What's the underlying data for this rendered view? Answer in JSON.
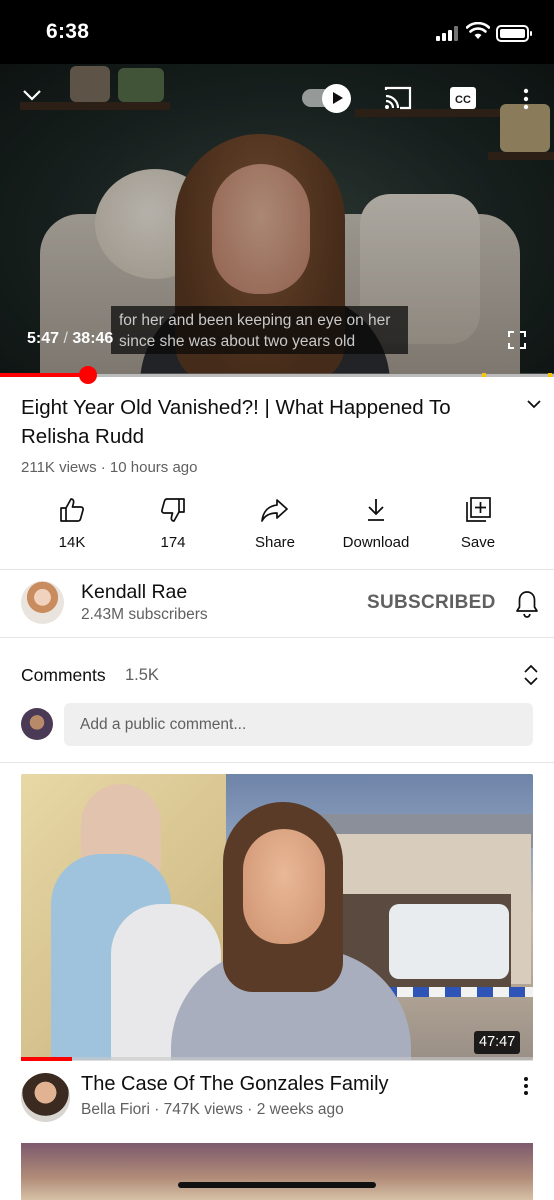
{
  "status_bar": {
    "time": "6:38"
  },
  "player": {
    "caption_line1": "for her and been keeping an eye on her",
    "caption_line2": "since she was about two years old",
    "current_time": "5:47",
    "separator": "/",
    "duration": "38:46",
    "progress_fraction": 0.159,
    "autoplay": "on",
    "icons": [
      "chevron-down-icon",
      "autoplay-toggle",
      "cast-icon",
      "cc-icon",
      "more-vert-icon",
      "fullscreen-icon"
    ]
  },
  "video": {
    "title": "Eight Year Old Vanished?! | What Happened To Relisha Rudd",
    "meta": "211K views · 10 hours ago"
  },
  "actions": [
    {
      "icon": "thumbs-up-icon",
      "label": "14K"
    },
    {
      "icon": "thumbs-down-icon",
      "label": "174"
    },
    {
      "icon": "share-icon",
      "label": "Share"
    },
    {
      "icon": "download-icon",
      "label": "Download"
    },
    {
      "icon": "save-playlist-icon",
      "label": "Save"
    }
  ],
  "channel": {
    "name": "Kendall Rae",
    "subscribers": "2.43M subscribers",
    "subscribe_state": "SUBSCRIBED"
  },
  "comments": {
    "title": "Comments",
    "count": "1.5K",
    "placeholder": "Add a public comment..."
  },
  "next_video": {
    "duration": "47:47",
    "watched_fraction": 0.1,
    "title": "The Case Of The Gonzales Family",
    "meta": "Bella Fiori · 747K views · 2 weeks ago"
  },
  "colors": {
    "accent": "#ff0000",
    "text": "#0f0f0f",
    "secondary": "#606060",
    "input_bg": "#efefef"
  }
}
